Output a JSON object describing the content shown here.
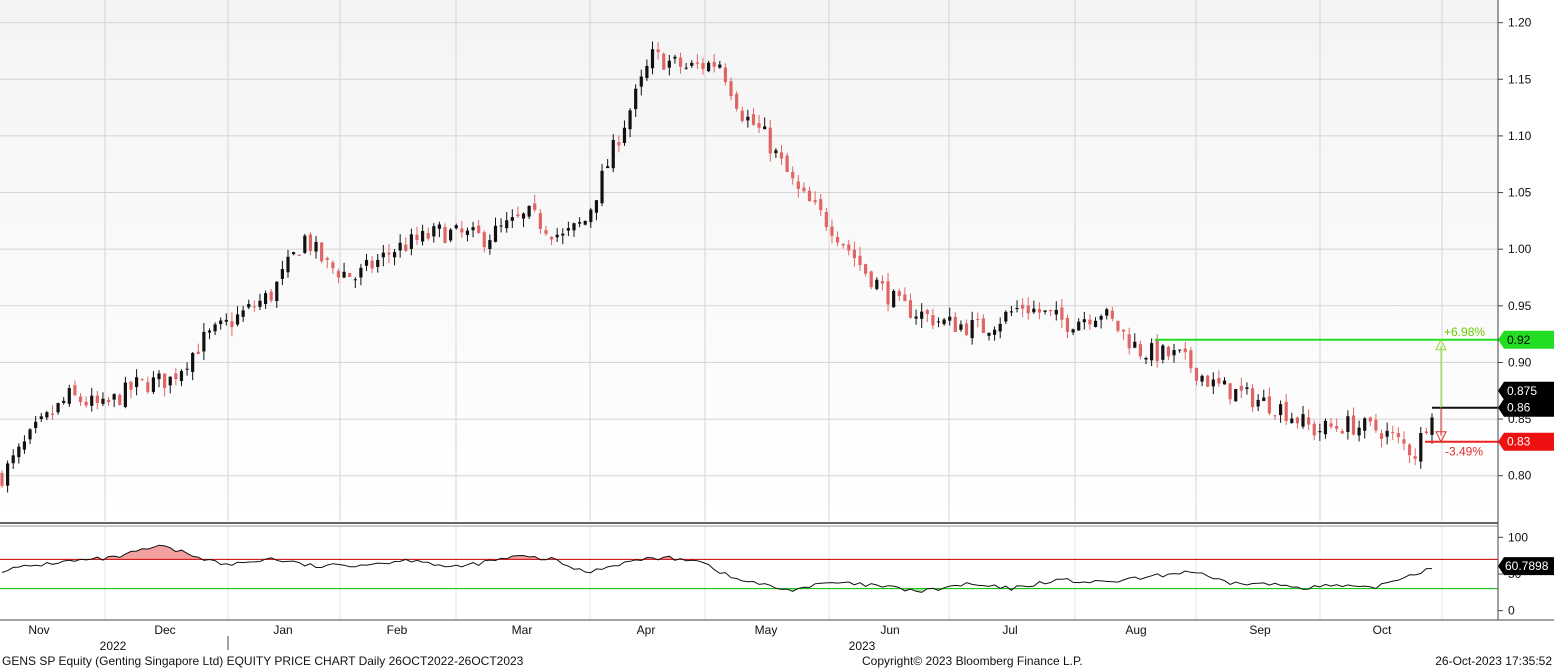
{
  "chart_data": {
    "type": "candlestick",
    "title": "GENS SP Equity (Genting Singapore Ltd) EQUITY PRICE CHART",
    "subtitle": "Daily 26OCT2022-26OCT2023",
    "ylim": [
      0.76,
      1.22
    ],
    "yticks": [
      "1.20",
      "1.15",
      "1.10",
      "1.05",
      "1.00",
      "0.95",
      "0.90",
      "0.85",
      "0.80"
    ],
    "yticks_values": [
      1.2,
      1.15,
      1.1,
      1.05,
      1.0,
      0.95,
      0.9,
      0.85,
      0.8
    ],
    "grid": true,
    "months": [
      "Nov",
      "Dec",
      "Jan",
      "Feb",
      "Mar",
      "Apr",
      "May",
      "Jun",
      "Jul",
      "Aug",
      "Sep",
      "Oct"
    ],
    "years": [
      "2022",
      "2023"
    ],
    "price_labels": [
      {
        "label": "0.92",
        "value": 0.92,
        "color": "#00cc00"
      },
      {
        "label": "0.875",
        "value": 0.875,
        "color": "#000000"
      },
      {
        "label": "0.86",
        "value": 0.86,
        "color": "#000000"
      },
      {
        "label": "0.83",
        "value": 0.83,
        "color": "#e00000"
      }
    ],
    "annotations": [
      {
        "text": "+6.98%",
        "value": 0.92,
        "color": "#66cc00"
      },
      {
        "text": "-3.49%",
        "value": 0.83,
        "color": "#e03030"
      }
    ],
    "close_anchors": [
      [
        0,
        0.8
      ],
      [
        6,
        0.84
      ],
      [
        12,
        0.87
      ],
      [
        18,
        0.86
      ],
      [
        24,
        0.88
      ],
      [
        30,
        0.885
      ],
      [
        36,
        0.92
      ],
      [
        42,
        0.94
      ],
      [
        48,
        0.96
      ],
      [
        54,
        1.01
      ],
      [
        58,
        0.985
      ],
      [
        63,
        0.975
      ],
      [
        70,
        1.0
      ],
      [
        78,
        1.015
      ],
      [
        86,
        1.01
      ],
      [
        94,
        1.03
      ],
      [
        100,
        1.01
      ],
      [
        104,
        1.025
      ],
      [
        110,
        1.1
      ],
      [
        116,
        1.17
      ],
      [
        122,
        1.16
      ],
      [
        128,
        1.165
      ],
      [
        132,
        1.12
      ],
      [
        136,
        1.1
      ],
      [
        142,
        1.05
      ],
      [
        148,
        1.02
      ],
      [
        154,
        0.98
      ],
      [
        160,
        0.95
      ],
      [
        168,
        0.935
      ],
      [
        175,
        0.93
      ],
      [
        182,
        0.95
      ],
      [
        190,
        0.935
      ],
      [
        196,
        0.945
      ],
      [
        203,
        0.91
      ],
      [
        210,
        0.905
      ],
      [
        216,
        0.88
      ],
      [
        222,
        0.87
      ],
      [
        228,
        0.86
      ],
      [
        234,
        0.84
      ],
      [
        240,
        0.845
      ],
      [
        246,
        0.84
      ],
      [
        252,
        0.82
      ],
      [
        255,
        0.86
      ]
    ],
    "candle_count": 256,
    "rsi": {
      "ylim": [
        -10,
        110
      ],
      "yticks": [
        "100",
        "50",
        "0"
      ],
      "yticks_values": [
        100,
        50,
        0
      ],
      "overbought": 70,
      "oversold": 30,
      "last_label": "60.7898",
      "anchors": [
        [
          0,
          55
        ],
        [
          10,
          66
        ],
        [
          20,
          72
        ],
        [
          28,
          88
        ],
        [
          34,
          76
        ],
        [
          40,
          62
        ],
        [
          48,
          71
        ],
        [
          56,
          60
        ],
        [
          66,
          64
        ],
        [
          74,
          70
        ],
        [
          80,
          58
        ],
        [
          86,
          66
        ],
        [
          92,
          74
        ],
        [
          98,
          70
        ],
        [
          104,
          52
        ],
        [
          110,
          64
        ],
        [
          116,
          72
        ],
        [
          124,
          70
        ],
        [
          130,
          45
        ],
        [
          140,
          28
        ],
        [
          148,
          38
        ],
        [
          156,
          34
        ],
        [
          164,
          26
        ],
        [
          172,
          36
        ],
        [
          180,
          30
        ],
        [
          188,
          42
        ],
        [
          196,
          38
        ],
        [
          204,
          45
        ],
        [
          212,
          54
        ],
        [
          218,
          38
        ],
        [
          226,
          36
        ],
        [
          232,
          32
        ],
        [
          238,
          34
        ],
        [
          244,
          30
        ],
        [
          250,
          46
        ],
        [
          256,
          61
        ]
      ]
    }
  },
  "footer": {
    "left": "GENS SP Equity (Genting Singapore Ltd) EQUITY PRICE CHART  Daily 26OCT2022-26OCT2023",
    "mid": "Copyright© 2023 Bloomberg Finance L.P.",
    "right": "26-Oct-2023 17:35:52"
  }
}
